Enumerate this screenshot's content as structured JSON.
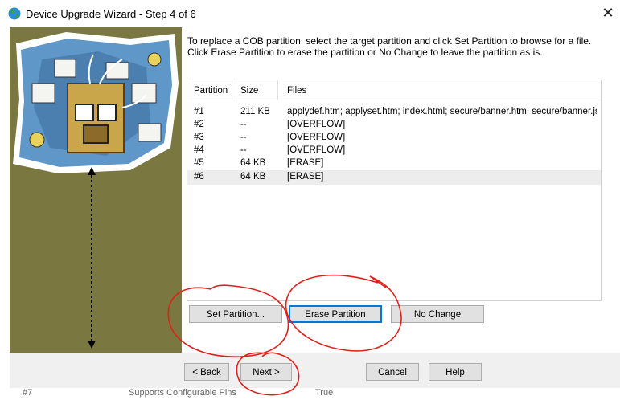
{
  "window": {
    "title": "Device Upgrade Wizard - Step 4 of 6",
    "close_glyph": "✕"
  },
  "instructions": "To replace a COB partition, select the target partition and click Set Partition to browse for a file.  Click Erase Partition to erase the partition or No Change to leave the partition as is.",
  "table": {
    "columns": [
      "Partition",
      "Size",
      "Files"
    ],
    "rows": [
      {
        "partition": "#1",
        "size": "211 KB",
        "files": "applydef.htm; applyset.htm; index.html; secure/banner.htm; secure/banner.js; se..."
      },
      {
        "partition": "#2",
        "size": "--",
        "files": "[OVERFLOW]"
      },
      {
        "partition": "#3",
        "size": "--",
        "files": "[OVERFLOW]"
      },
      {
        "partition": "#4",
        "size": "--",
        "files": "[OVERFLOW]"
      },
      {
        "partition": "#5",
        "size": "64 KB",
        "files": "[ERASE]"
      },
      {
        "partition": "#6",
        "size": "64 KB",
        "files": "[ERASE]"
      }
    ],
    "selected_row": 5
  },
  "actions": {
    "set_partition": "Set Partition...",
    "erase_partition": "Erase Partition",
    "no_change": "No Change"
  },
  "nav": {
    "back": "< Back",
    "next": "Next >",
    "cancel": "Cancel",
    "help": "Help"
  },
  "behind": {
    "col1": "#7",
    "col2": "Supports Configurable Pins",
    "col3": "True"
  },
  "colors": {
    "side_panel": "#7a7740",
    "annotation": "#e0201a",
    "focus": "#0078d7"
  }
}
